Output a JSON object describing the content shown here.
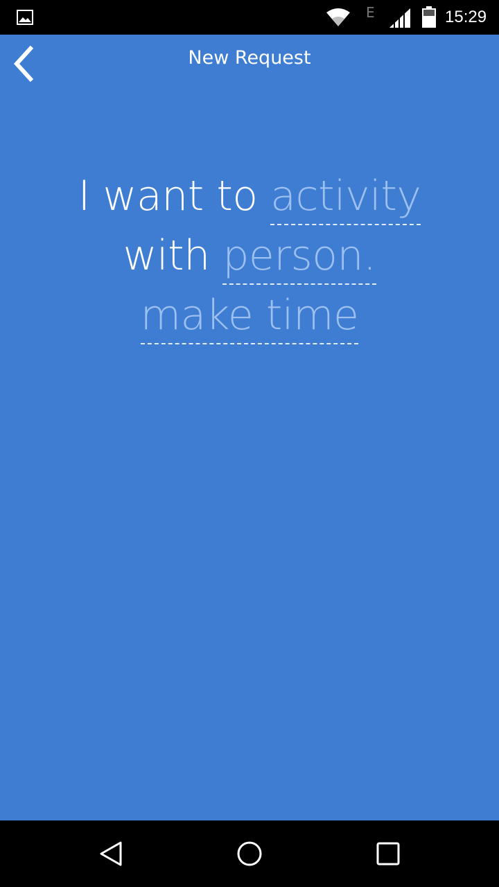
{
  "status_bar": {
    "network_type": "E",
    "time": "15:29",
    "icons": [
      "gallery-icon",
      "wifi-icon",
      "signal-icon",
      "battery-icon"
    ]
  },
  "app_bar": {
    "title": "New Request",
    "back_icon": "chevron-left-icon"
  },
  "sentence": {
    "line1_prefix": "I want to",
    "activity_placeholder": "activity",
    "line2_prefix": "with",
    "person_placeholder": "person.",
    "time_placeholder": "make time"
  },
  "nav_bar": {
    "icons": [
      "back-triangle-icon",
      "home-circle-icon",
      "recents-square-icon"
    ]
  },
  "colors": {
    "background": "#3e7dd1",
    "placeholder_text": "#9dc0f1",
    "text": "#ffffff",
    "system_bars": "#000000"
  }
}
